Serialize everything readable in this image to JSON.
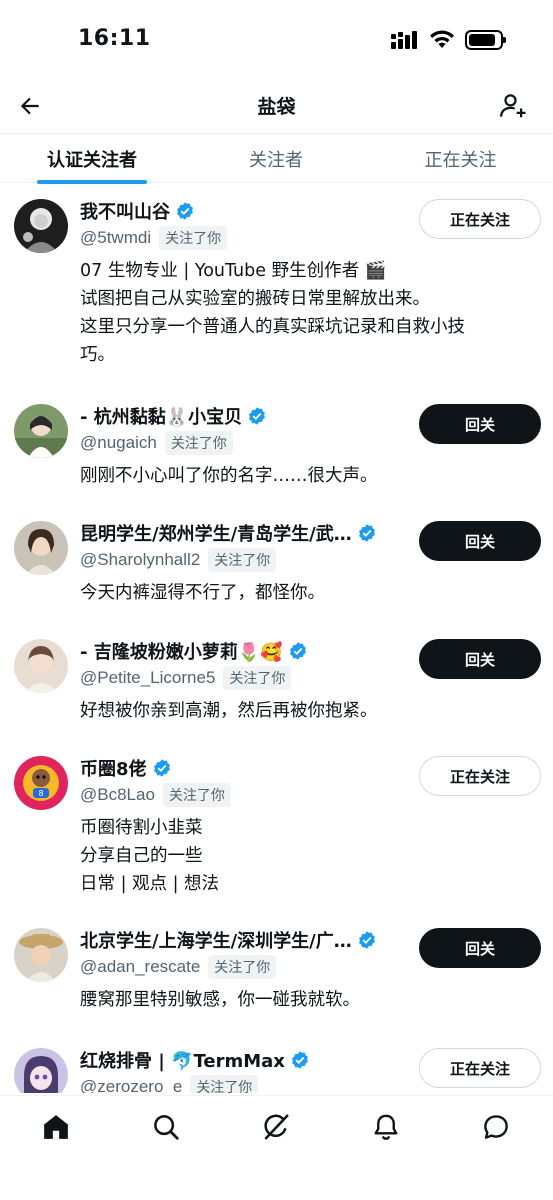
{
  "status_bar": {
    "time": "16:11",
    "battery_level": 0.85
  },
  "header": {
    "title": "盐袋"
  },
  "tabs": [
    {
      "label": "认证关注者",
      "active": true
    },
    {
      "label": "关注者",
      "active": false
    },
    {
      "label": "正在关注",
      "active": false
    }
  ],
  "users": [
    {
      "name": "我不叫山谷",
      "handle": "@5twmdi",
      "follows_you": "关注了你",
      "button": "正在关注",
      "button_type": "following",
      "bio_lines": [
        "07 生物专业 | YouTube 野生创作者 🎬",
        "试图把自己从实验室的搬砖日常里解放出来。",
        "这里只分享一个普通人的真实踩坑记录和自救小技",
        "巧。"
      ]
    },
    {
      "name": "- 杭州黏黏🐰小宝贝",
      "handle": "@nugaich",
      "follows_you": "关注了你",
      "button": "回关",
      "button_type": "followback",
      "bio_lines": [
        "刚刚不小心叫了你的名字……很大声。"
      ]
    },
    {
      "name": "昆明学生/郑州学生/青岛学生/武…",
      "handle": "@Sharolynhall2",
      "follows_you": "关注了你",
      "button": "回关",
      "button_type": "followback",
      "bio_lines": [
        "今天内裤湿得不行了，都怪你。"
      ]
    },
    {
      "name": "- 吉隆坡粉嫩小萝莉🌷🥰",
      "handle": "@Petite_Licorne5",
      "follows_you": "关注了你",
      "button": "回关",
      "button_type": "followback",
      "bio_lines": [
        "好想被你亲到高潮，然后再被你抱紧。"
      ]
    },
    {
      "name": "币圈8佬",
      "handle": "@Bc8Lao",
      "follows_you": "关注了你",
      "button": "正在关注",
      "button_type": "following",
      "bio_lines": [
        "币圈待割小韭菜",
        "分享自己的一些",
        "日常 | 观点 | 想法"
      ]
    },
    {
      "name": "北京学生/上海学生/深圳学生/广…",
      "handle": "@adan_rescate",
      "follows_you": "关注了你",
      "button": "回关",
      "button_type": "followback",
      "bio_lines": [
        "腰窝那里特别敏感，你一碰我就软。"
      ]
    },
    {
      "name": "红烧排骨 | 🐬TermMax",
      "handle": "@zerozero_e",
      "follows_you": "关注了你",
      "button": "正在关注",
      "button_type": "following",
      "bio_lines": []
    }
  ],
  "colors": {
    "accent": "#1d9bf0",
    "text": "#0f1419",
    "secondary": "#536471"
  },
  "nav_icons": [
    "home-icon",
    "search-icon",
    "grok-icon",
    "bell-icon",
    "messages-icon"
  ]
}
